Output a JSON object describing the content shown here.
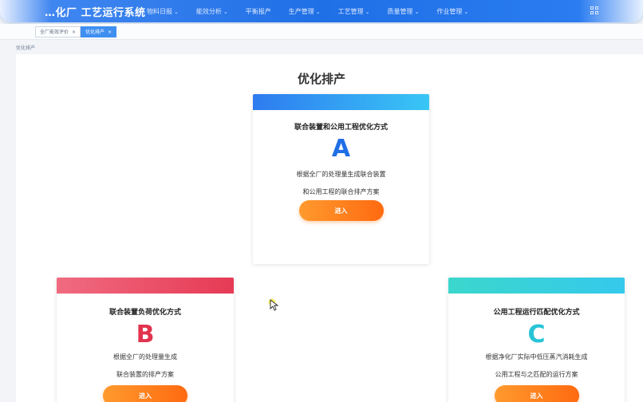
{
  "header": {
    "brand": "…化厂 工艺运行系统",
    "menu": [
      {
        "label": "物料日报"
      },
      {
        "label": "能效分析"
      },
      {
        "label": "平衡报产"
      },
      {
        "label": "生产管理"
      },
      {
        "label": "工艺管理"
      },
      {
        "label": "质量管理"
      },
      {
        "label": "作业管理"
      }
    ]
  },
  "tabs": [
    {
      "label": "全厂能效评价",
      "active": false
    },
    {
      "label": "优化排产",
      "active": true
    }
  ],
  "breadcrumb": "优化排产",
  "page_title": "优化排产",
  "cards": {
    "a": {
      "title": "联合装置和公用工程优化方式",
      "letter": "A",
      "desc_line1": "根据全厂的处理量生成联合装置",
      "desc_line2": "和公用工程的联合排产方案",
      "button": "进入",
      "accent": "#1f6fe6"
    },
    "b": {
      "title": "联合装置负荷优化方式",
      "letter": "B",
      "desc_line1": "根据全厂的处理量生成",
      "desc_line2": "联合装置的排产方案",
      "button": "进入",
      "accent": "#e2334d"
    },
    "c": {
      "title": "公用工程运行匹配优化方式",
      "letter": "C",
      "desc_line1": "根据净化厂实际中低压蒸汽消耗生成",
      "desc_line2": "公用工程与之匹配的运行方案",
      "button": "进入",
      "accent": "#27c4d6"
    }
  },
  "icons": {
    "chevron": "chevron-down-icon",
    "apps": "apps-grid-icon",
    "close": "close-icon",
    "cursor": "mouse-pointer-icon"
  }
}
